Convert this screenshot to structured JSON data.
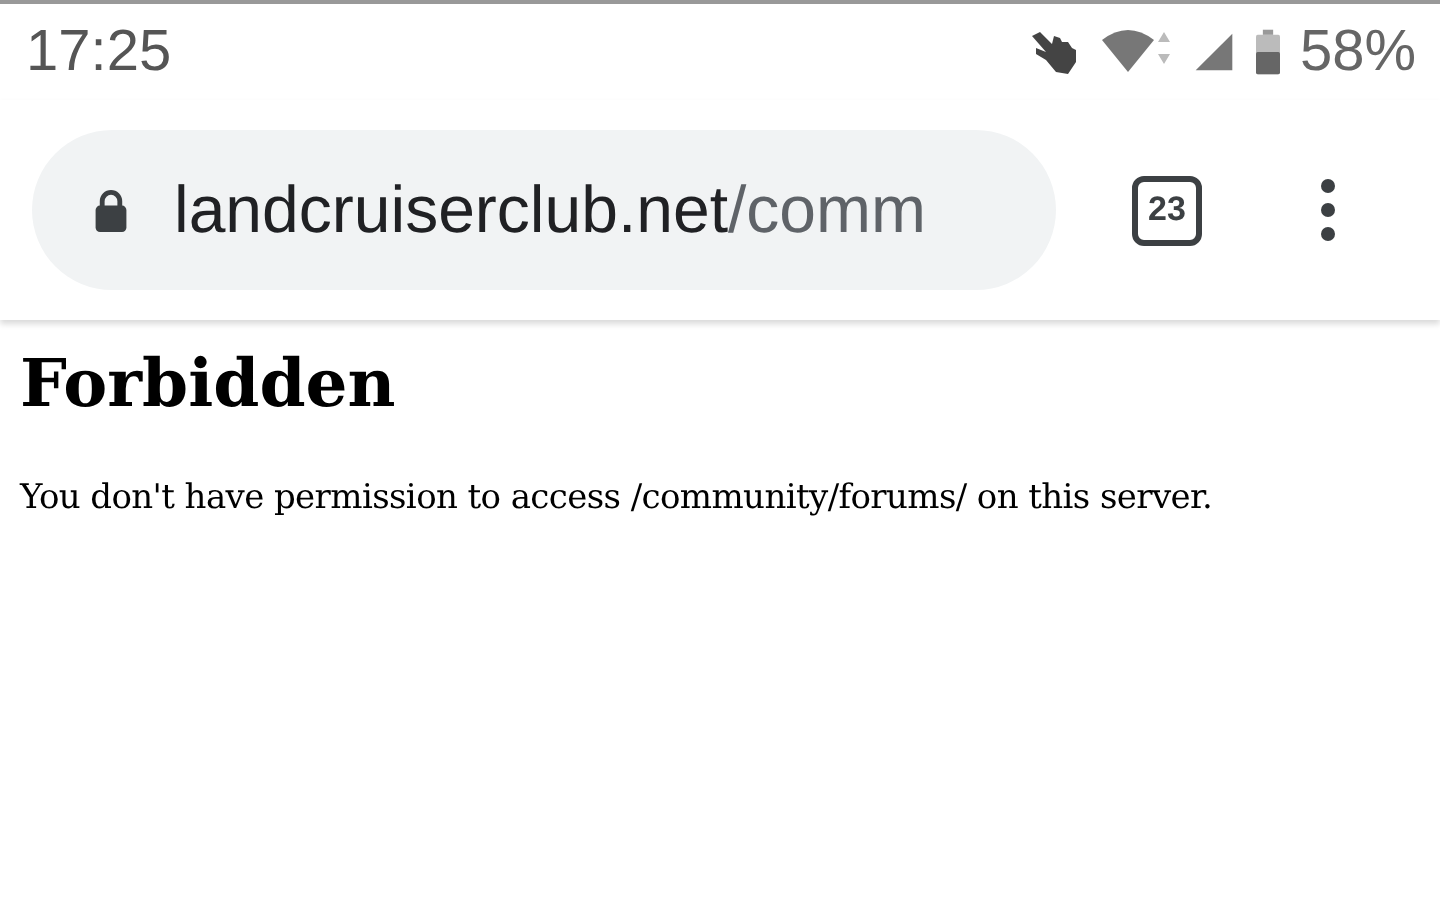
{
  "status_bar": {
    "time": "17:25",
    "battery": "58%"
  },
  "address_bar": {
    "host": "landcruiserclub.net",
    "path": "/comm"
  },
  "tab_count": "23",
  "page": {
    "heading": "Forbidden",
    "message": "You don't have permission to access /community/forums/ on this server."
  }
}
